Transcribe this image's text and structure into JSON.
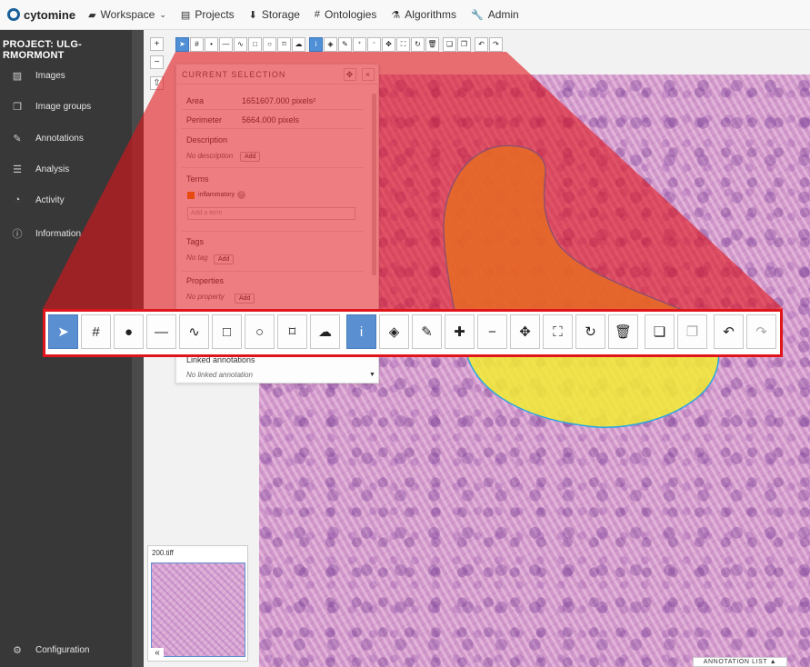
{
  "app": {
    "brand": "cytomine"
  },
  "nav": {
    "workspace": "Workspace",
    "projects": "Projects",
    "storage": "Storage",
    "ontologies": "Ontologies",
    "algorithms": "Algorithms",
    "admin": "Admin"
  },
  "sidebar": {
    "project_title": "PROJECT: ULG-RMORMONT",
    "items": [
      {
        "label": "Images",
        "icon": "images-icon"
      },
      {
        "label": "Image groups",
        "icon": "image-groups-icon"
      },
      {
        "label": "Annotations",
        "icon": "annotations-icon"
      },
      {
        "label": "Analysis",
        "icon": "analysis-icon"
      },
      {
        "label": "Activity",
        "icon": "activity-icon"
      },
      {
        "label": "Information",
        "icon": "info-icon"
      }
    ],
    "configuration": "Configuration"
  },
  "panel": {
    "title": "CURRENT SELECTION",
    "area_label": "Area",
    "area_value": "1651607.000 pixels²",
    "perimeter_label": "Perimeter",
    "perimeter_value": "5664.000 pixels",
    "description_label": "Description",
    "description_empty": "No description",
    "add": "Add",
    "terms_label": "Terms",
    "term": "inflammatory",
    "add_term_placeholder": "Add a term",
    "tags_label": "Tags",
    "tags_empty": "No tag",
    "properties_label": "Properties",
    "properties_empty": "No property",
    "linked_label": "Linked annotations",
    "linked_empty": "No linked annotation"
  },
  "thumbnail": {
    "name": "200.tiff"
  },
  "annotation_list": "ANNOTATION LIST ▲",
  "colors": {
    "highlight": "#e0141b",
    "active_tool": "#5a8fd1",
    "term_color": "#f08a00"
  }
}
